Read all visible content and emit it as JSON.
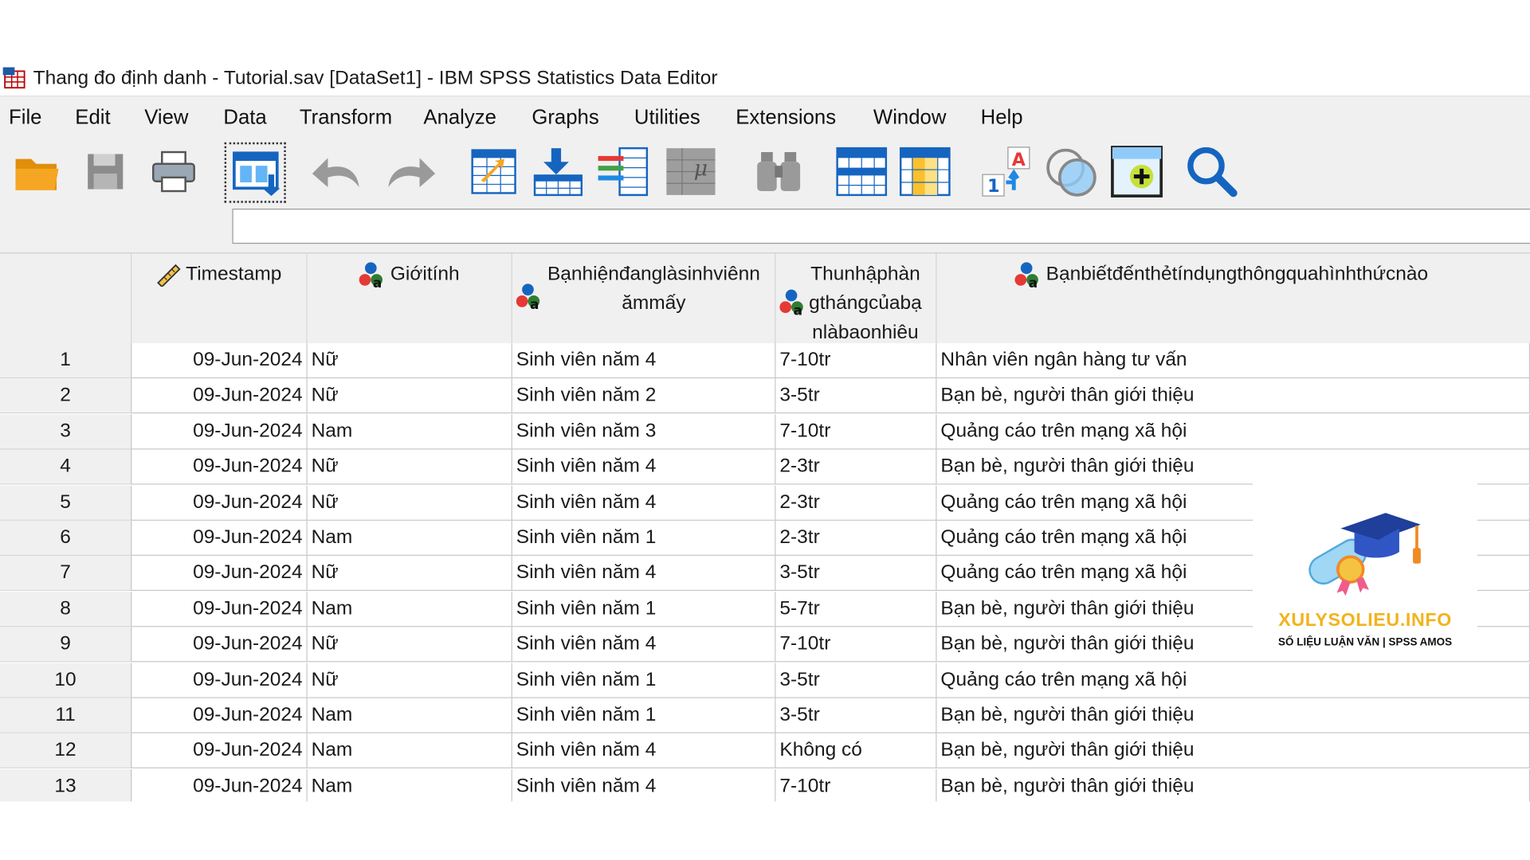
{
  "window": {
    "title": "Thang đo định danh - Tutorial.sav [DataSet1] - IBM SPSS Statistics Data Editor"
  },
  "menu": [
    "File",
    "Edit",
    "View",
    "Data",
    "Transform",
    "Analyze",
    "Graphs",
    "Utilities",
    "Extensions",
    "Window",
    "Help"
  ],
  "toolbar": {
    "icons": [
      "open-folder-icon",
      "save-icon",
      "print-icon",
      "recall-dialog-icon",
      "undo-icon",
      "redo-icon",
      "go-to-case-icon",
      "go-to-variable-icon",
      "variables-icon",
      "run-descriptives-icon",
      "find-icon",
      "insert-cases-icon",
      "insert-variable-icon",
      "split-file-icon",
      "select-cases-icon",
      "value-labels-icon",
      "use-variable-sets-icon",
      "search-icon"
    ]
  },
  "cell_editor": {
    "value": ""
  },
  "columns": [
    {
      "label": "Timestamp",
      "icon": "scale-ruler-icon"
    },
    {
      "label": "Giớitính",
      "icon": "nominal-string-icon"
    },
    {
      "label": "Bạnhiệnđanglàsinhviênn\nămmấy",
      "icon": "nominal-string-icon"
    },
    {
      "label": "Thunhậphàn\ngthángcủabạ\nnlàbaonhiêu",
      "icon": "nominal-string-icon"
    },
    {
      "label": "Bạnbiếtđếnthẻtíndụngthôngquahìnhthứcnào",
      "icon": "nominal-string-icon"
    }
  ],
  "rows": [
    {
      "n": "1",
      "c": [
        "09-Jun-2024",
        "Nữ",
        "Sinh viên năm 4",
        "7-10tr",
        "Nhân viên ngân hàng tư vấn"
      ]
    },
    {
      "n": "2",
      "c": [
        "09-Jun-2024",
        "Nữ",
        "Sinh viên năm 2",
        "3-5tr",
        "Bạn bè, người thân giới thiệu"
      ]
    },
    {
      "n": "3",
      "c": [
        "09-Jun-2024",
        "Nam",
        "Sinh viên năm 3",
        "7-10tr",
        "Quảng cáo trên mạng xã hội"
      ]
    },
    {
      "n": "4",
      "c": [
        "09-Jun-2024",
        "Nữ",
        "Sinh viên năm 4",
        "2-3tr",
        "Bạn bè, người thân giới thiệu"
      ]
    },
    {
      "n": "5",
      "c": [
        "09-Jun-2024",
        "Nữ",
        "Sinh viên năm 4",
        "2-3tr",
        "Quảng cáo trên mạng xã hội"
      ]
    },
    {
      "n": "6",
      "c": [
        "09-Jun-2024",
        "Nam",
        "Sinh viên năm 1",
        "2-3tr",
        "Quảng cáo trên mạng xã hội"
      ]
    },
    {
      "n": "7",
      "c": [
        "09-Jun-2024",
        "Nữ",
        "Sinh viên năm 4",
        "3-5tr",
        "Quảng cáo trên mạng xã hội"
      ]
    },
    {
      "n": "8",
      "c": [
        "09-Jun-2024",
        "Nam",
        "Sinh viên năm 1",
        "5-7tr",
        "Bạn bè, người thân giới thiệu"
      ]
    },
    {
      "n": "9",
      "c": [
        "09-Jun-2024",
        "Nữ",
        "Sinh viên năm 4",
        "7-10tr",
        "Bạn bè, người thân giới thiệu"
      ]
    },
    {
      "n": "10",
      "c": [
        "09-Jun-2024",
        "Nữ",
        "Sinh viên năm 1",
        "3-5tr",
        "Quảng cáo trên mạng xã hội"
      ]
    },
    {
      "n": "11",
      "c": [
        "09-Jun-2024",
        "Nam",
        "Sinh viên năm 1",
        "3-5tr",
        "Bạn bè, người thân giới thiệu"
      ]
    },
    {
      "n": "12",
      "c": [
        "09-Jun-2024",
        "Nam",
        "Sinh viên năm 4",
        "Không có",
        "Bạn bè, người thân giới thiệu"
      ]
    },
    {
      "n": "13",
      "c": [
        "09-Jun-2024",
        "Nam",
        "Sinh viên năm 4",
        "7-10tr",
        "Bạn bè, người thân giới thiệu"
      ]
    }
  ],
  "watermark": {
    "title": "XULYSOLIEU.INFO",
    "subtitle": "SỐ LIỆU LUẬN VĂN | SPSS AMOS"
  },
  "colors": {
    "accent_blue": "#1565c0",
    "folder": "#f5a623",
    "grid_line": "#c8c8c8",
    "header_bg": "#f0f0f0",
    "watermark_gold": "#f2b31c"
  }
}
